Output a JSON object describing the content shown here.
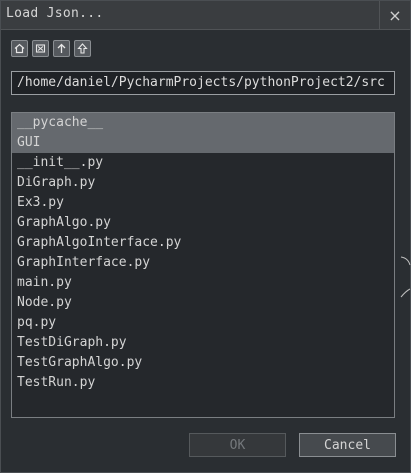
{
  "dialog": {
    "title": "Load Json...",
    "close_glyph": "×"
  },
  "toolbar": {
    "buttons": [
      "home-icon",
      "delete-icon",
      "arrow-up-icon",
      "parent-dir-icon"
    ]
  },
  "path": {
    "value": "/home/daniel/PycharmProjects/pythonProject2/src"
  },
  "files": [
    {
      "name": "__pycache__"
    },
    {
      "name": "GUI"
    },
    {
      "name": "__init__.py"
    },
    {
      "name": "DiGraph.py"
    },
    {
      "name": "Ex3.py"
    },
    {
      "name": "GraphAlgo.py"
    },
    {
      "name": "GraphAlgoInterface.py"
    },
    {
      "name": "GraphInterface.py"
    },
    {
      "name": "main.py"
    },
    {
      "name": "Node.py"
    },
    {
      "name": "pq.py"
    },
    {
      "name": "TestDiGraph.py"
    },
    {
      "name": "TestGraphAlgo.py"
    },
    {
      "name": "TestRun.py"
    }
  ],
  "buttons": {
    "ok": "OK",
    "cancel": "Cancel"
  },
  "colors": {
    "background": "#2a2e32",
    "selection": "#65696e",
    "text": "#d4d4d4"
  }
}
